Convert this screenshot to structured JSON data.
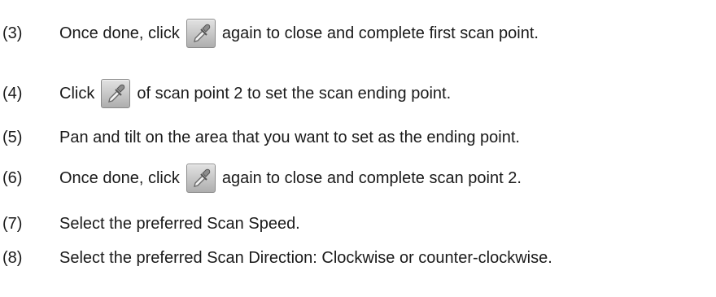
{
  "steps": [
    {
      "num": "(3)",
      "before": "Once done, click",
      "icon": "eyedropper-icon",
      "after": "again to close and complete first scan point."
    },
    {
      "num": "(4)",
      "before": "Click",
      "icon": "eyedropper-icon",
      "after": "of scan point 2 to set the scan ending point."
    },
    {
      "num": "(5)",
      "text": "Pan and tilt on the area that you want to set as the ending point."
    },
    {
      "num": "(6)",
      "before": "Once done, click",
      "icon": "eyedropper-icon",
      "after": "again to close and complete scan point 2."
    },
    {
      "num": "(7)",
      "text": "Select the preferred Scan Speed."
    },
    {
      "num": "(8)",
      "text": "Select the preferred Scan Direction: Clockwise or counter-clockwise."
    }
  ]
}
